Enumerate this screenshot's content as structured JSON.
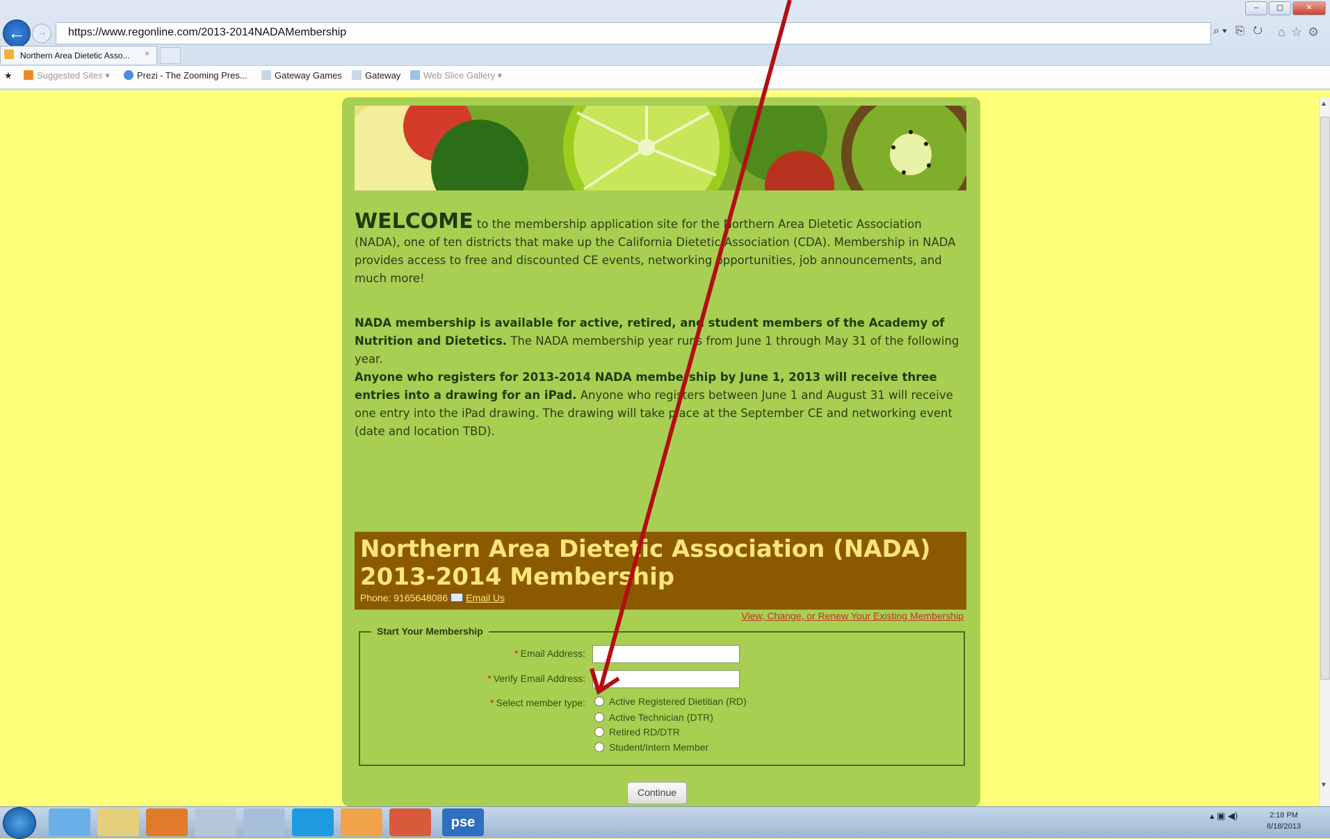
{
  "browser": {
    "url": "https://www.regonline.com/2013-2014NADAMembership",
    "tab_title": "Northern Area Dietetic Asso...",
    "tab_close": "×",
    "favorites": [
      "Suggested Sites ▾",
      "Prezi - The Zooming Pres...",
      "Gateway Games",
      "Gateway",
      "Web Slice Gallery ▾"
    ],
    "window_buttons": [
      "–",
      "▢",
      "✕"
    ]
  },
  "page": {
    "welcome_word": "WELCOME",
    "welcome_rest": " to the membership application site for the Northern Area Dietetic Association (NADA), one of ten districts that make up the California Dietetic Association (CDA). Membership in NADA provides access to free and discounted CE events, networking opportunities, job announcements, and much more!",
    "para2_bold": "NADA membership is available for active, retired, and student members of the Academy of Nutrition and Dietetics.",
    "para2_rest": " The NADA membership year runs from June 1 through May 31 of the following year.",
    "para3_bold": "Anyone who registers for 2013-2014 NADA membership by June 1, 2013 will receive three entries into a drawing for an iPad.",
    "para3_rest": " Anyone who registers between June 1 and August 31 will receive one entry into the iPad drawing. The drawing will take place at the September CE and networking event (date and location TBD).",
    "title_line1": "Northern Area Dietetic Association (NADA)",
    "title_line2": "2013-2014 Membership",
    "phone": "Phone: 9165648086",
    "email_us": "Email Us",
    "existing_link": "View, Change, or Renew Your Existing Membership"
  },
  "form": {
    "legend": "Start Your Membership",
    "email_label": "Email Address:",
    "verify_label": "Verify Email Address:",
    "member_type_label": "Select member type:",
    "email_value": "",
    "verify_value": "",
    "options": [
      "Active Registered Dietitian (RD)",
      "Active Technician (DTR)",
      "Retired RD/DTR",
      "Student/Intern Member"
    ],
    "continue": "Continue"
  },
  "taskbar": {
    "time": "2:18 PM",
    "date": "8/18/2013",
    "pse_label": "pse"
  },
  "colors": {
    "page_bg": "#ffff7a",
    "panel": "#a8cf52",
    "title_band": "#8b5a00",
    "title_text": "#ffe67a",
    "arrow": "#b40d14"
  }
}
